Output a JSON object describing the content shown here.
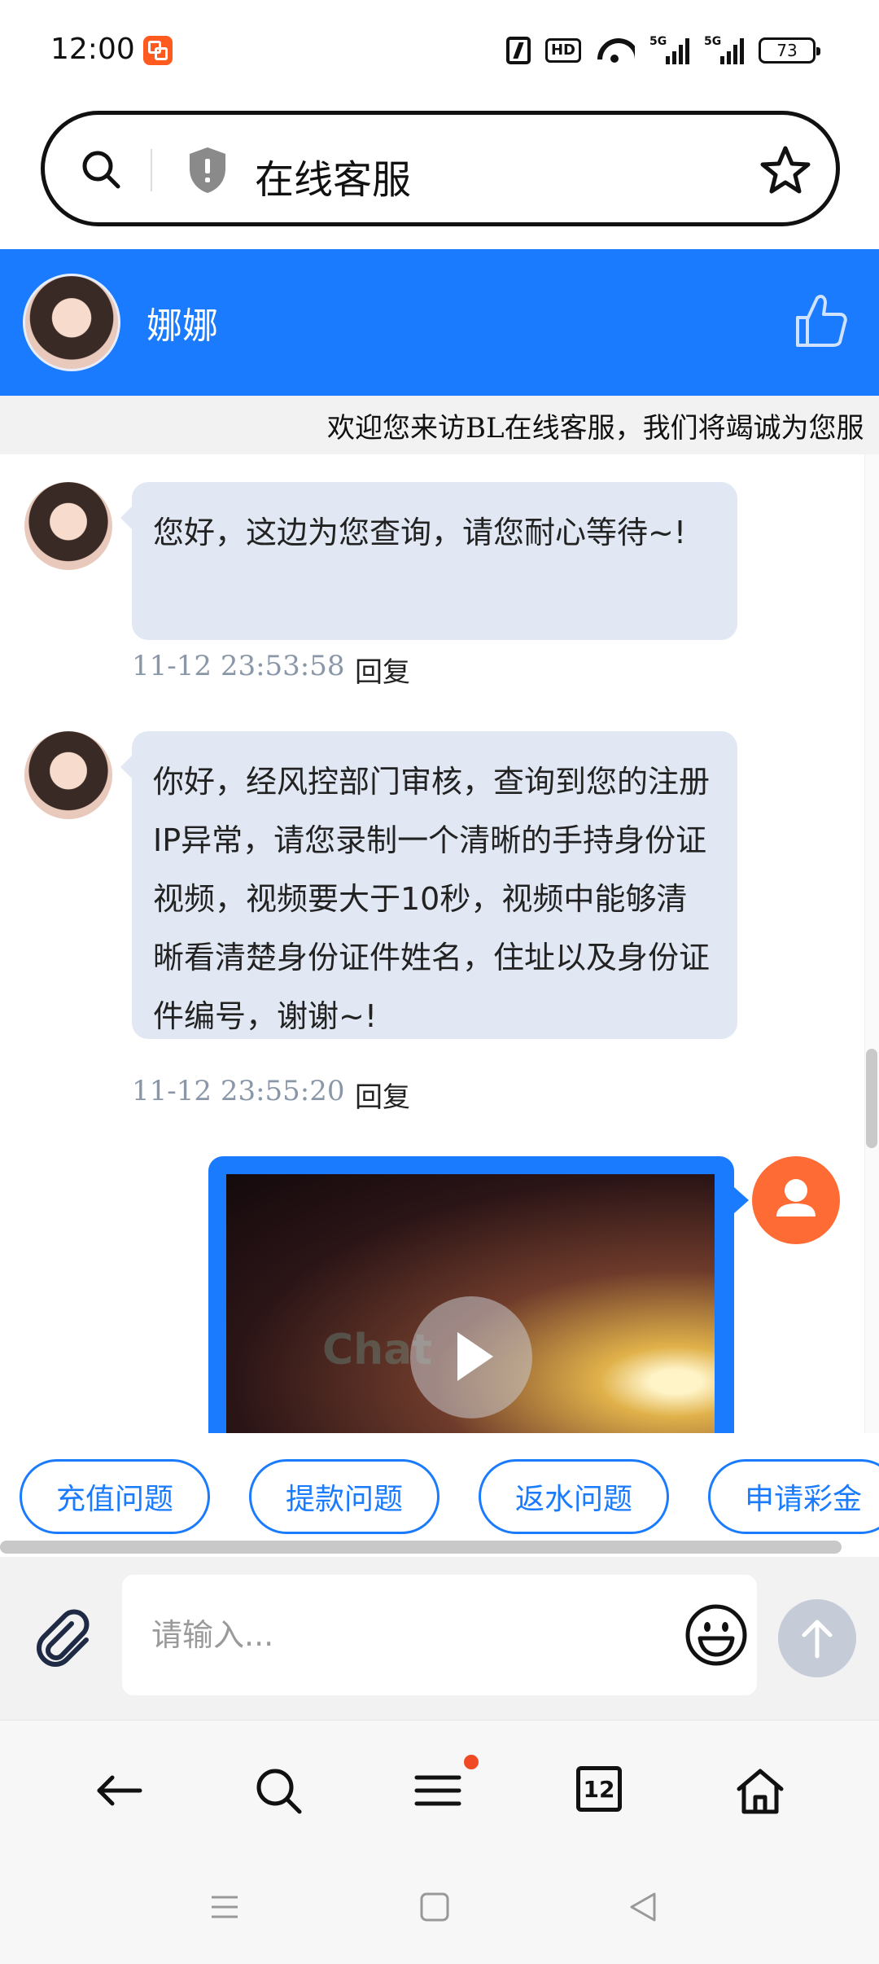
{
  "status_bar": {
    "time": "12:00",
    "hd_label": "HD",
    "signal1_label": "5G",
    "signal2_label": "5G",
    "battery": "73"
  },
  "search": {
    "text": "在线客服"
  },
  "header": {
    "agent_name": "娜娜"
  },
  "marquee": {
    "text": "欢迎您来访BL在线客服，我们将竭诚为您服"
  },
  "messages": [
    {
      "text": "您好，这边为您查询，请您耐心等待~!",
      "time": "11-12 23:53:58",
      "reply": "回复"
    },
    {
      "text": "你好，经风控部门审核，查询到您的注册IP异常，请您录制一个清晰的手持身份证视频，视频要大于10秒，视频中能够清晰看清楚身份证件姓名，住址以及身份证件编号，谢谢~!",
      "time": "11-12 23:55:20",
      "reply": "回复"
    }
  ],
  "video": {
    "watermark": "Chat"
  },
  "quick_replies": [
    "充值问题",
    "提款问题",
    "返水问题",
    "申请彩金"
  ],
  "composer": {
    "placeholder": "请输入..."
  },
  "browser_nav": {
    "tabs_count": "12"
  },
  "colors": {
    "brand_blue": "#1a7bff",
    "bubble_bg": "#e2e8f3",
    "user_avatar": "#ff6b35",
    "notification_dot": "#f04a25"
  },
  "icons": [
    "search-icon",
    "shield-icon",
    "star-icon",
    "thumbs-up-icon",
    "play-icon",
    "paperclip-icon",
    "emoji-icon",
    "send-arrow-icon",
    "back-arrow-icon",
    "menu-icon",
    "tabs-icon",
    "home-icon"
  ]
}
